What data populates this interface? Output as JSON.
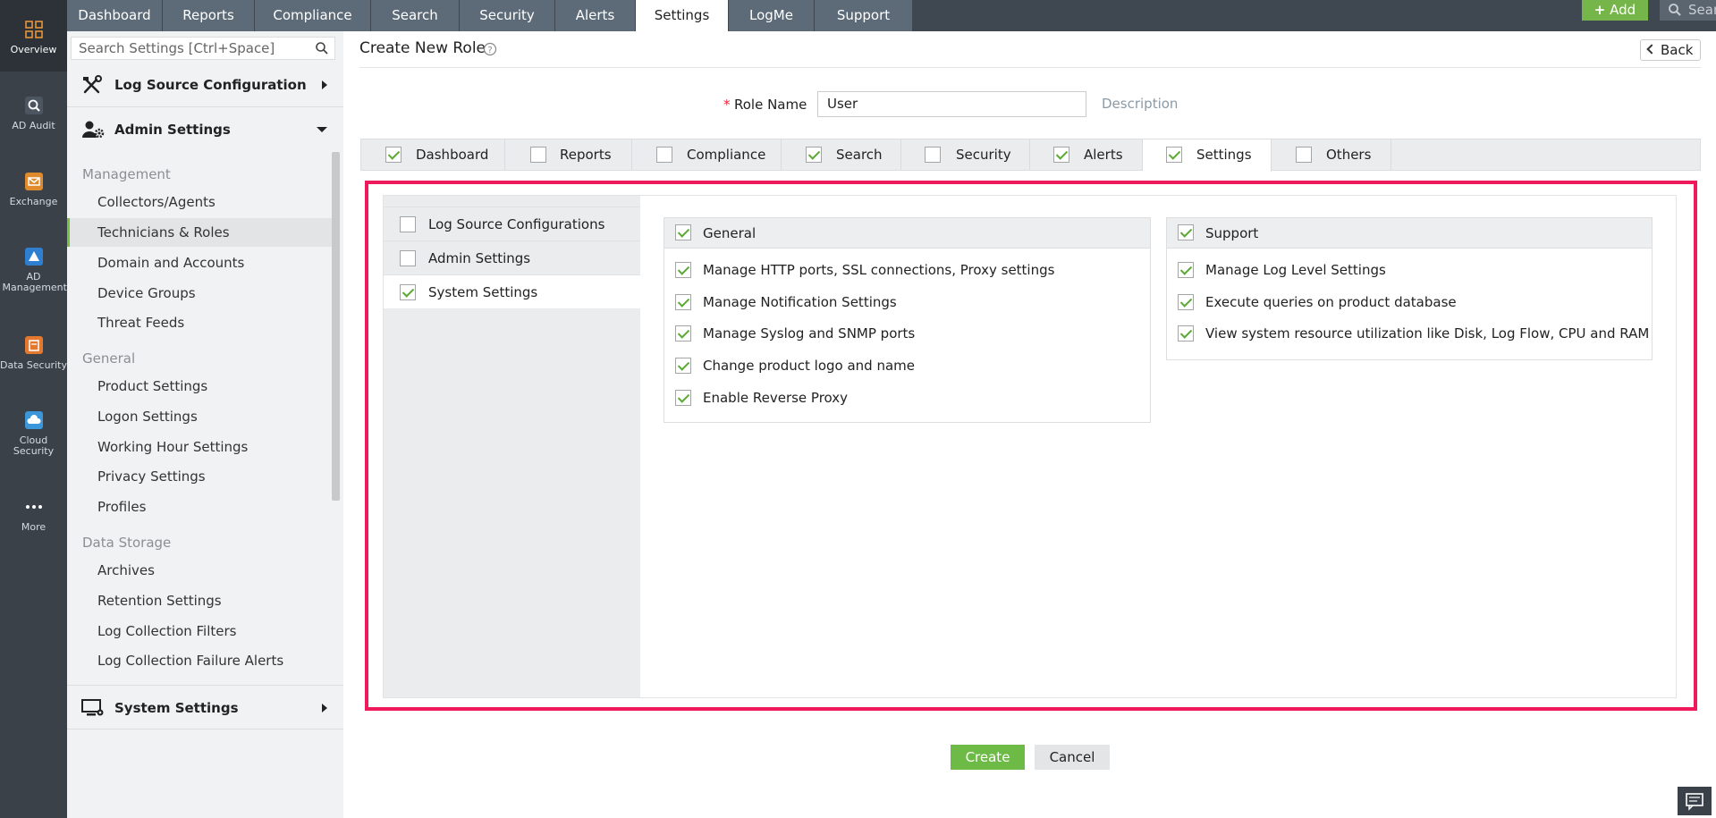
{
  "rail": [
    {
      "label": "Overview",
      "icon": "grid-icon"
    },
    {
      "label": "AD Audit",
      "icon": "ad-audit-icon"
    },
    {
      "label": "Exchange",
      "icon": "exchange-icon"
    },
    {
      "label": "AD Management",
      "icon": "ad-management-icon"
    },
    {
      "label": "Data Security",
      "icon": "data-security-icon"
    },
    {
      "label": "Cloud Security",
      "icon": "cloud-security-icon"
    },
    {
      "label": "More",
      "icon": "more-icon"
    }
  ],
  "topnav": {
    "tabs": [
      "Dashboard",
      "Reports",
      "Compliance",
      "Search",
      "Security",
      "Alerts",
      "Settings",
      "LogMe",
      "Support"
    ],
    "active_tab": "Settings",
    "add_label": "Add",
    "search_placeholder": "Search"
  },
  "sidebar": {
    "search_placeholder": "Search Settings [Ctrl+Space]",
    "sections": {
      "log_source": "Log Source Configuration",
      "admin": "Admin Settings",
      "system": "System Settings"
    },
    "groups": {
      "management": {
        "label": "Management",
        "items": [
          "Collectors/Agents",
          "Technicians & Roles",
          "Domain and Accounts",
          "Device Groups",
          "Threat Feeds"
        ]
      },
      "general": {
        "label": "General",
        "items": [
          "Product Settings",
          "Logon Settings",
          "Working Hour Settings",
          "Privacy Settings",
          "Profiles"
        ]
      },
      "data_storage": {
        "label": "Data Storage",
        "items": [
          "Archives",
          "Retention Settings",
          "Log Collection Filters",
          "Log Collection Failure Alerts"
        ]
      }
    },
    "active_item": "Technicians & Roles"
  },
  "main": {
    "title": "Create New Role",
    "back_label": "Back",
    "role_name_label": "Role Name",
    "role_name_value": "User",
    "description_label": "Description",
    "module_tabs": [
      {
        "label": "Dashboard",
        "checked": true
      },
      {
        "label": "Reports",
        "checked": false
      },
      {
        "label": "Compliance",
        "checked": false
      },
      {
        "label": "Search",
        "checked": true
      },
      {
        "label": "Security",
        "checked": false
      },
      {
        "label": "Alerts",
        "checked": true
      },
      {
        "label": "Settings",
        "checked": true
      },
      {
        "label": "Others",
        "checked": false
      }
    ],
    "active_module": "Settings",
    "subnav": [
      {
        "label": "Log Source Configurations",
        "checked": false
      },
      {
        "label": "Admin Settings",
        "checked": false
      },
      {
        "label": "System Settings",
        "checked": true
      }
    ],
    "active_subnav": "System Settings",
    "general_card": {
      "title": "General",
      "checked": true,
      "permissions": [
        "Manage HTTP ports, SSL connections, Proxy settings",
        "Manage Notification Settings",
        "Manage Syslog and SNMP ports",
        "Change product logo and name",
        "Enable Reverse Proxy"
      ]
    },
    "support_card": {
      "title": "Support",
      "checked": true,
      "permissions": [
        "Manage Log Level Settings",
        "Execute queries on product database",
        "View system resource utilization like Disk, Log Flow, CPU and RAM"
      ]
    },
    "create_label": "Create",
    "cancel_label": "Cancel"
  },
  "colors": {
    "accent_green": "#76b54a",
    "highlight_border": "#ee1a5b",
    "rail_bg": "#3a4149",
    "nav_tab_bg": "#5d6a77"
  }
}
